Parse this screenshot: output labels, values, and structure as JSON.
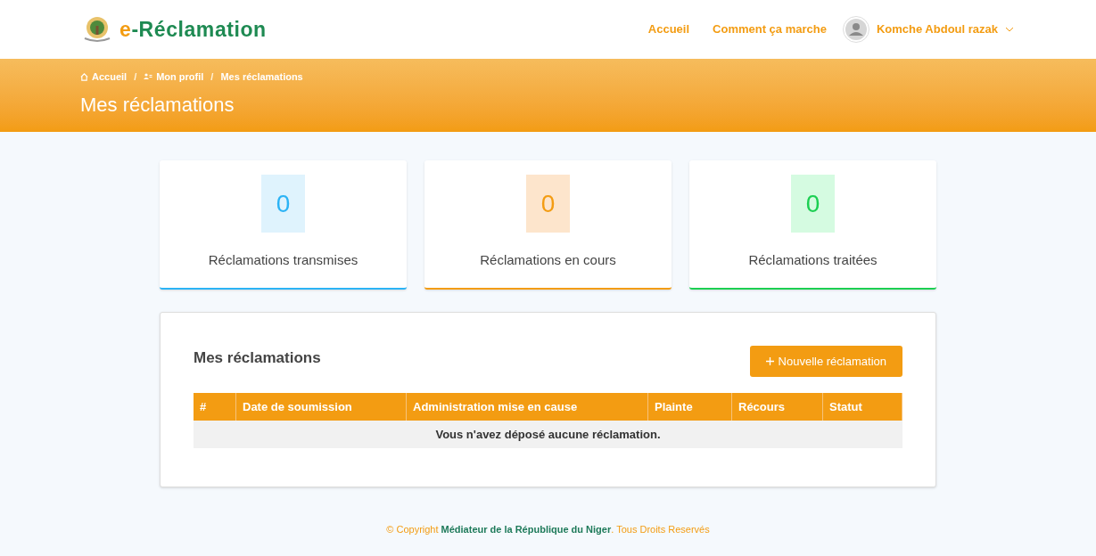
{
  "header": {
    "logo_prefix": "e",
    "logo_rest": "-Réclamation",
    "nav": [
      {
        "label": "Accueil"
      },
      {
        "label": "Comment ça marche"
      }
    ],
    "user": "Komche Abdoul razak"
  },
  "banner": {
    "separator": "/",
    "breadcrumb": [
      {
        "label": "Accueil",
        "kind": "home"
      },
      {
        "label": "Mon profil",
        "kind": "profile"
      },
      {
        "label": "Mes réclamations",
        "kind": "current"
      }
    ],
    "title": "Mes réclamations"
  },
  "stats": [
    {
      "value": "0",
      "label": "Réclamations transmises",
      "color": "#2bb3f5"
    },
    {
      "value": "0",
      "label": "Réclamations en cours",
      "color": "#f39c12"
    },
    {
      "value": "0",
      "label": "Réclamations traitées",
      "color": "#1ccf52"
    }
  ],
  "panel": {
    "title": "Mes réclamations",
    "button": "Nouvelle réclamation",
    "columns": [
      "#",
      "Date de soumission",
      "Administration mise en cause",
      "Plainte",
      "Récours",
      "Statut"
    ],
    "empty": "Vous n'avez déposé aucune réclamation."
  },
  "footer": {
    "prefix": "© Copyright",
    "link": "Médiateur de la République du Niger",
    "suffix": ". Tous Droits Reservés"
  }
}
